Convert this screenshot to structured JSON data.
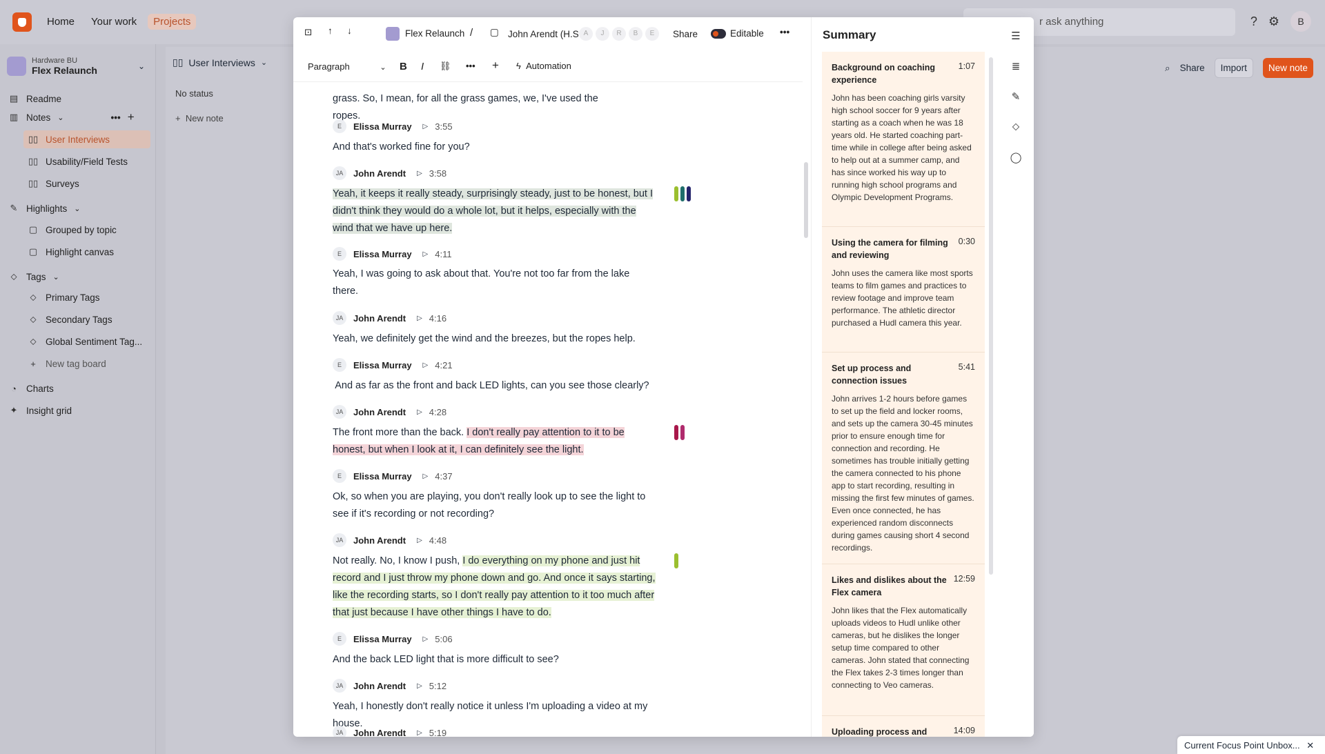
{
  "topnav": {
    "home": "Home",
    "work": "Your work",
    "projects": "Projects"
  },
  "search": {
    "placeholder": "r ask anything"
  },
  "user": {
    "initial": "B"
  },
  "workspace": {
    "org": "Hardware BU",
    "name": "Flex Relaunch"
  },
  "sidebar": {
    "readme": "Readme",
    "notes": "Notes",
    "notes_items": [
      "User Interviews",
      "Usability/Field Tests",
      "Surveys"
    ],
    "highlights": "Highlights",
    "highlights_items": [
      "Grouped by topic",
      "Highlight canvas"
    ],
    "tags": "Tags",
    "tags_items": [
      "Primary Tags",
      "Secondary Tags",
      "Global Sentiment Tag..."
    ],
    "new_tag_board": "New tag board",
    "charts": "Charts",
    "insight_grid": "Insight grid"
  },
  "board": {
    "title": "User Interviews",
    "no_status": "No status",
    "new_note": "New note",
    "share": "Share",
    "import": "Import",
    "new_note_btn": "New note"
  },
  "doc": {
    "project": "Flex Relaunch",
    "sep": "/",
    "note_title": "John Arendt (H.S",
    "share": "Share",
    "editable": "Editable",
    "paragraph": "Paragraph",
    "automation": "Automation",
    "participants": [
      "A",
      "J",
      "R",
      "B",
      "E"
    ]
  },
  "transcript": [
    {
      "type": "text",
      "text": "grass. So, I mean, for all the grass games, we, I've used the ropes."
    },
    {
      "type": "speaker",
      "initials": "E",
      "name": "Elissa Murray",
      "time": "3:55"
    },
    {
      "type": "text",
      "text": "And that's worked fine for you?"
    },
    {
      "type": "speaker",
      "initials": "JA",
      "name": "John Arendt",
      "time": "3:58"
    },
    {
      "type": "text",
      "text": "Yeah, it keeps it really steady, surprisingly steady, just to be honest, but I didn't think they would do a whole lot, but it helps, especially with the wind that we have up here."
    },
    {
      "type": "speaker",
      "initials": "E",
      "name": "Elissa Murray",
      "time": "4:11"
    },
    {
      "type": "text",
      "text": "Yeah, I was going to ask about that. You're not too far from the lake there."
    },
    {
      "type": "speaker",
      "initials": "JA",
      "name": "John Arendt",
      "time": "4:16"
    },
    {
      "type": "text",
      "text": "Yeah, we definitely get the wind and the breezes, but the ropes help."
    },
    {
      "type": "speaker",
      "initials": "E",
      "name": "Elissa Murray",
      "time": "4:21"
    },
    {
      "type": "text",
      "text": " And as far as the front and back LED lights, can you see those clearly?"
    },
    {
      "type": "speaker",
      "initials": "JA",
      "name": "John Arendt",
      "time": "4:28"
    },
    {
      "type": "text_split",
      "plain": "The front more than the back. ",
      "highlighted": "I don't really pay attention to it to be honest, but when I look at it, I can definitely see the light."
    },
    {
      "type": "speaker",
      "initials": "E",
      "name": "Elissa Murray",
      "time": "4:37"
    },
    {
      "type": "text",
      "text": "Ok, so when you are playing, you don't really look up to see the light to see if it's recording or not recording?"
    },
    {
      "type": "speaker",
      "initials": "JA",
      "name": "John Arendt",
      "time": "4:48"
    },
    {
      "type": "text_split",
      "plain": "Not really. No, I know I push, ",
      "highlighted": "I do everything on my phone and just hit record and I just throw my phone down and go. And once it says starting, like the recording starts, so I don't really pay attention to it too much after that just because I have other things I have to do."
    },
    {
      "type": "speaker",
      "initials": "E",
      "name": "Elissa Murray",
      "time": "5:06"
    },
    {
      "type": "text",
      "text": "And the back LED light that is more difficult to see?"
    },
    {
      "type": "speaker",
      "initials": "JA",
      "name": "John Arendt",
      "time": "5:12"
    },
    {
      "type": "text",
      "text": "Yeah, I honestly don't really notice it unless I'm uploading a video at my house."
    },
    {
      "type": "speaker",
      "initials": "JA",
      "name": "John Arendt",
      "time": "5:19"
    }
  ],
  "highlight_colors": {
    "row1": [
      "#9bbf2f",
      "#1f6e6b",
      "#23236b"
    ],
    "row2": [
      "#a8174a",
      "#b02b6d"
    ],
    "row3": [
      "#9bbf2f"
    ]
  },
  "summary": {
    "title": "Summary",
    "items": [
      {
        "title": "Background on coaching experience",
        "time": "1:07",
        "body": "John has been coaching girls varsity high school soccer for 9 years after starting as a coach when he was 18 years old. He started coaching part-time while in college after being asked to help out at a summer camp, and has since worked his way up to running high school programs and Olympic Development Programs."
      },
      {
        "title": "Using the camera for filming and reviewing",
        "time": "0:30",
        "body": "John uses the camera like most sports teams to film games and practices to review footage and improve team performance. The athletic director purchased a Hudl camera this year."
      },
      {
        "title": "Set up process and connection issues",
        "time": "5:41",
        "body": "John arrives 1-2 hours before games to set up the field and locker rooms, and sets up the camera 30-45 minutes prior to ensure enough time for connection and recording. He sometimes has trouble initially getting the camera connected to his phone app to start recording, resulting in missing the first few minutes of games. Even once connected, he has experienced random disconnects during games causing short 4 second recordings."
      },
      {
        "title": "Likes and dislikes about the Flex camera",
        "time": "12:59",
        "body": "John likes that the Flex automatically uploads videos to Hudl unlike other cameras, but he dislikes the longer setup time compared to other cameras. John stated that connecting the Flex takes 2-3 times longer than connecting to Veo cameras."
      },
      {
        "title": "Uploading process and",
        "time": "14:09",
        "body": ""
      }
    ]
  },
  "toast": {
    "text": "Current Focus Point Unbox..."
  }
}
